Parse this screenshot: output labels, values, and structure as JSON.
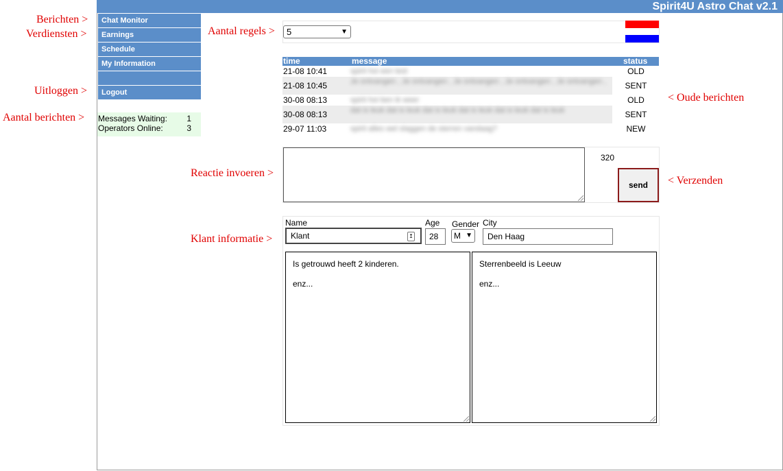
{
  "app": {
    "title": "Spirit4U Astro Chat v2.1"
  },
  "annotations": {
    "berichten": "Berichten >",
    "verdiensten": "Verdiensten >",
    "uitloggen": "Uitloggen >",
    "aantal_berichten": "Aantal berichten >",
    "aantal_regels": "Aantal regels >",
    "oude_berichten": "< Oude berichten",
    "reactie_invoeren": "Reactie invoeren >",
    "verzenden": "< Verzenden",
    "klant_informatie": "Klant informatie >"
  },
  "nav": {
    "chat_monitor": "Chat Monitor",
    "earnings": "Earnings",
    "schedule": "Schedule",
    "my_information": "My Information",
    "blank": "",
    "logout": "Logout"
  },
  "stats": {
    "waiting_label": "Messages Waiting:",
    "waiting_value": "1",
    "online_label": "Operators Online:",
    "online_value": "3"
  },
  "rules": {
    "selected": "5"
  },
  "flag": {
    "top_color": "#ff0000",
    "bottom_color": "#0000ff"
  },
  "messages": {
    "headers": {
      "time": "time",
      "message": "message",
      "status": "status"
    },
    "rows": [
      {
        "time": "21-08 10:41",
        "message": "spirit hoi een test",
        "status": "OLD"
      },
      {
        "time": "21-08 10:45",
        "message": "Je ontvangen , Je ontvangen , Je ontvangen , Je ontvangen , Je ontvangen ,",
        "status": "SENT"
      },
      {
        "time": "30-08 08:13",
        "message": "spirit hoi ben ik weer",
        "status": "OLD"
      },
      {
        "time": "30-08 08:13",
        "message": "dat is leuk dat is leuk dat is leuk dat is leuk dat is leuk dat is leuk",
        "status": "SENT"
      },
      {
        "time": "29-07 11:03",
        "message": "spirit alles wel slaggen de sterren vandaag?",
        "status": "NEW"
      }
    ]
  },
  "reply": {
    "char_count": "320",
    "send_label": "send"
  },
  "client": {
    "name_label": "Name",
    "name_value": "Klant",
    "age_label": "Age",
    "age_value": "28",
    "gender_label": "Gender",
    "gender_value": "M",
    "city_label": "City",
    "city_value": "Den Haag",
    "notes_left": [
      "Is getrouwd heeft 2 kinderen.",
      "enz..."
    ],
    "notes_right": [
      "Sterrenbeeld is Leeuw",
      "enz..."
    ]
  },
  "colors": {
    "accent": "#5b8ec9",
    "annotation": "#e00000",
    "stats_bg": "#e7fbe7"
  }
}
